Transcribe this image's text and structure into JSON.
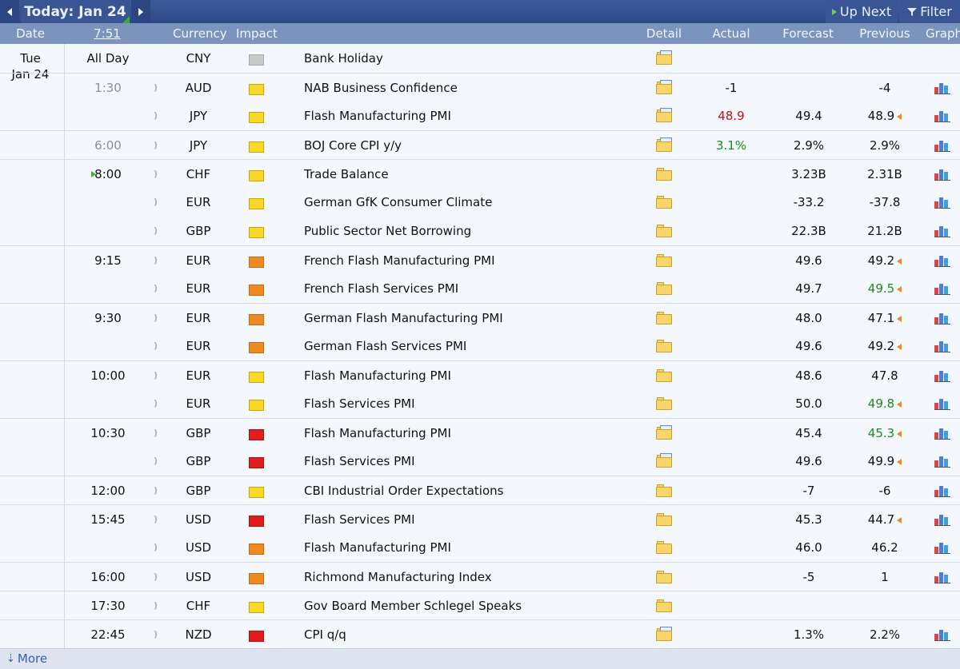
{
  "toolbar": {
    "today_label": "Today: Jan 24",
    "up_next_label": "Up Next",
    "filter_label": "Filter"
  },
  "columns": {
    "date": "Date",
    "time": "7:51",
    "currency": "Currency",
    "impact": "Impact",
    "detail": "Detail",
    "actual": "Actual",
    "forecast": "Forecast",
    "previous": "Previous",
    "graph": "Graph"
  },
  "day": {
    "name": "Tue",
    "date": "Jan 24"
  },
  "icons": {
    "prev": "chevron-left-icon",
    "next": "chevron-right-icon",
    "up_next": "play-icon",
    "filter": "funnel-icon",
    "sound": "sound-alert-icon",
    "detail": "folder-icon",
    "graph": "bar-chart-icon",
    "revision": "revision-arrow-icon",
    "more": "down-arrow-icon"
  },
  "colors": {
    "impact_holiday": "#c9c9c9",
    "impact_low": "#f6d82b",
    "impact_medium": "#ef8a22",
    "impact_high": "#e21d1d",
    "worse": "#b9131b",
    "better": "#1f8a1f"
  },
  "events": [
    {
      "time": "All Day",
      "currency": "CNY",
      "impact": "holiday",
      "event": "Bank Holiday",
      "actual": "",
      "forecast": "",
      "previous": "",
      "sound": false,
      "graph": false
    },
    {
      "time": "1:30",
      "time_past": true,
      "currency": "AUD",
      "impact": "yellow",
      "event": "NAB Business Confidence",
      "actual": "-1",
      "forecast": "",
      "previous": "-4",
      "sound": true,
      "graph": true
    },
    {
      "time": "",
      "currency": "JPY",
      "impact": "yellow",
      "event": "Flash Manufacturing PMI",
      "actual": "48.9",
      "actual_color": "red",
      "forecast": "49.4",
      "previous": "48.9",
      "prev_revised": true,
      "sound": true,
      "graph": true
    },
    {
      "time": "6:00",
      "time_past": true,
      "currency": "JPY",
      "impact": "yellow",
      "event": "BOJ Core CPI y/y",
      "actual": "3.1%",
      "actual_color": "green",
      "forecast": "2.9%",
      "previous": "2.9%",
      "sound": true,
      "graph": true
    },
    {
      "time": "8:00",
      "current": true,
      "currency": "CHF",
      "impact": "yellow",
      "event": "Trade Balance",
      "actual": "",
      "forecast": "3.23B",
      "previous": "2.31B",
      "sound": true,
      "graph": true
    },
    {
      "time": "",
      "currency": "EUR",
      "impact": "yellow",
      "event": "German GfK Consumer Climate",
      "actual": "",
      "forecast": "-33.2",
      "previous": "-37.8",
      "sound": true,
      "graph": true
    },
    {
      "time": "",
      "currency": "GBP",
      "impact": "yellow",
      "event": "Public Sector Net Borrowing",
      "actual": "",
      "forecast": "22.3B",
      "previous": "21.2B",
      "sound": true,
      "graph": true
    },
    {
      "time": "9:15",
      "currency": "EUR",
      "impact": "orange",
      "event": "French Flash Manufacturing PMI",
      "actual": "",
      "forecast": "49.6",
      "previous": "49.2",
      "prev_revised": true,
      "sound": true,
      "graph": true
    },
    {
      "time": "",
      "currency": "EUR",
      "impact": "orange",
      "event": "French Flash Services PMI",
      "actual": "",
      "forecast": "49.7",
      "previous": "49.5",
      "prev_color": "green",
      "prev_revised": true,
      "sound": true,
      "graph": true
    },
    {
      "time": "9:30",
      "currency": "EUR",
      "impact": "orange",
      "event": "German Flash Manufacturing PMI",
      "actual": "",
      "forecast": "48.0",
      "previous": "47.1",
      "prev_revised": true,
      "sound": true,
      "graph": true
    },
    {
      "time": "",
      "currency": "EUR",
      "impact": "orange",
      "event": "German Flash Services PMI",
      "actual": "",
      "forecast": "49.6",
      "previous": "49.2",
      "prev_revised": true,
      "sound": true,
      "graph": true
    },
    {
      "time": "10:00",
      "currency": "EUR",
      "impact": "yellow",
      "event": "Flash Manufacturing PMI",
      "actual": "",
      "forecast": "48.6",
      "previous": "47.8",
      "sound": true,
      "graph": true
    },
    {
      "time": "",
      "currency": "EUR",
      "impact": "yellow",
      "event": "Flash Services PMI",
      "actual": "",
      "forecast": "50.0",
      "previous": "49.8",
      "prev_color": "green",
      "prev_revised": true,
      "sound": true,
      "graph": true
    },
    {
      "time": "10:30",
      "currency": "GBP",
      "impact": "red",
      "event": "Flash Manufacturing PMI",
      "actual": "",
      "forecast": "45.4",
      "previous": "45.3",
      "prev_color": "green",
      "prev_revised": true,
      "sound": true,
      "graph": true
    },
    {
      "time": "",
      "currency": "GBP",
      "impact": "red",
      "event": "Flash Services PMI",
      "actual": "",
      "forecast": "49.6",
      "previous": "49.9",
      "prev_revised": true,
      "sound": true,
      "graph": true
    },
    {
      "time": "12:00",
      "currency": "GBP",
      "impact": "yellow",
      "event": "CBI Industrial Order Expectations",
      "actual": "",
      "forecast": "-7",
      "previous": "-6",
      "sound": true,
      "graph": true
    },
    {
      "time": "15:45",
      "currency": "USD",
      "impact": "red",
      "event": "Flash Services PMI",
      "actual": "",
      "forecast": "45.3",
      "previous": "44.7",
      "prev_revised": true,
      "sound": true,
      "graph": true
    },
    {
      "time": "",
      "currency": "USD",
      "impact": "orange",
      "event": "Flash Manufacturing PMI",
      "actual": "",
      "forecast": "46.0",
      "previous": "46.2",
      "sound": true,
      "graph": true
    },
    {
      "time": "16:00",
      "currency": "USD",
      "impact": "orange",
      "event": "Richmond Manufacturing Index",
      "actual": "",
      "forecast": "-5",
      "previous": "1",
      "sound": true,
      "graph": true
    },
    {
      "time": "17:30",
      "currency": "CHF",
      "impact": "yellow",
      "event": "Gov Board Member Schlegel Speaks",
      "actual": "",
      "forecast": "",
      "previous": "",
      "sound": true,
      "graph": false
    },
    {
      "time": "22:45",
      "currency": "NZD",
      "impact": "red",
      "event": "CPI q/q",
      "actual": "",
      "forecast": "1.3%",
      "previous": "2.2%",
      "sound": true,
      "graph": true
    }
  ],
  "footer": {
    "more_label": "More"
  }
}
